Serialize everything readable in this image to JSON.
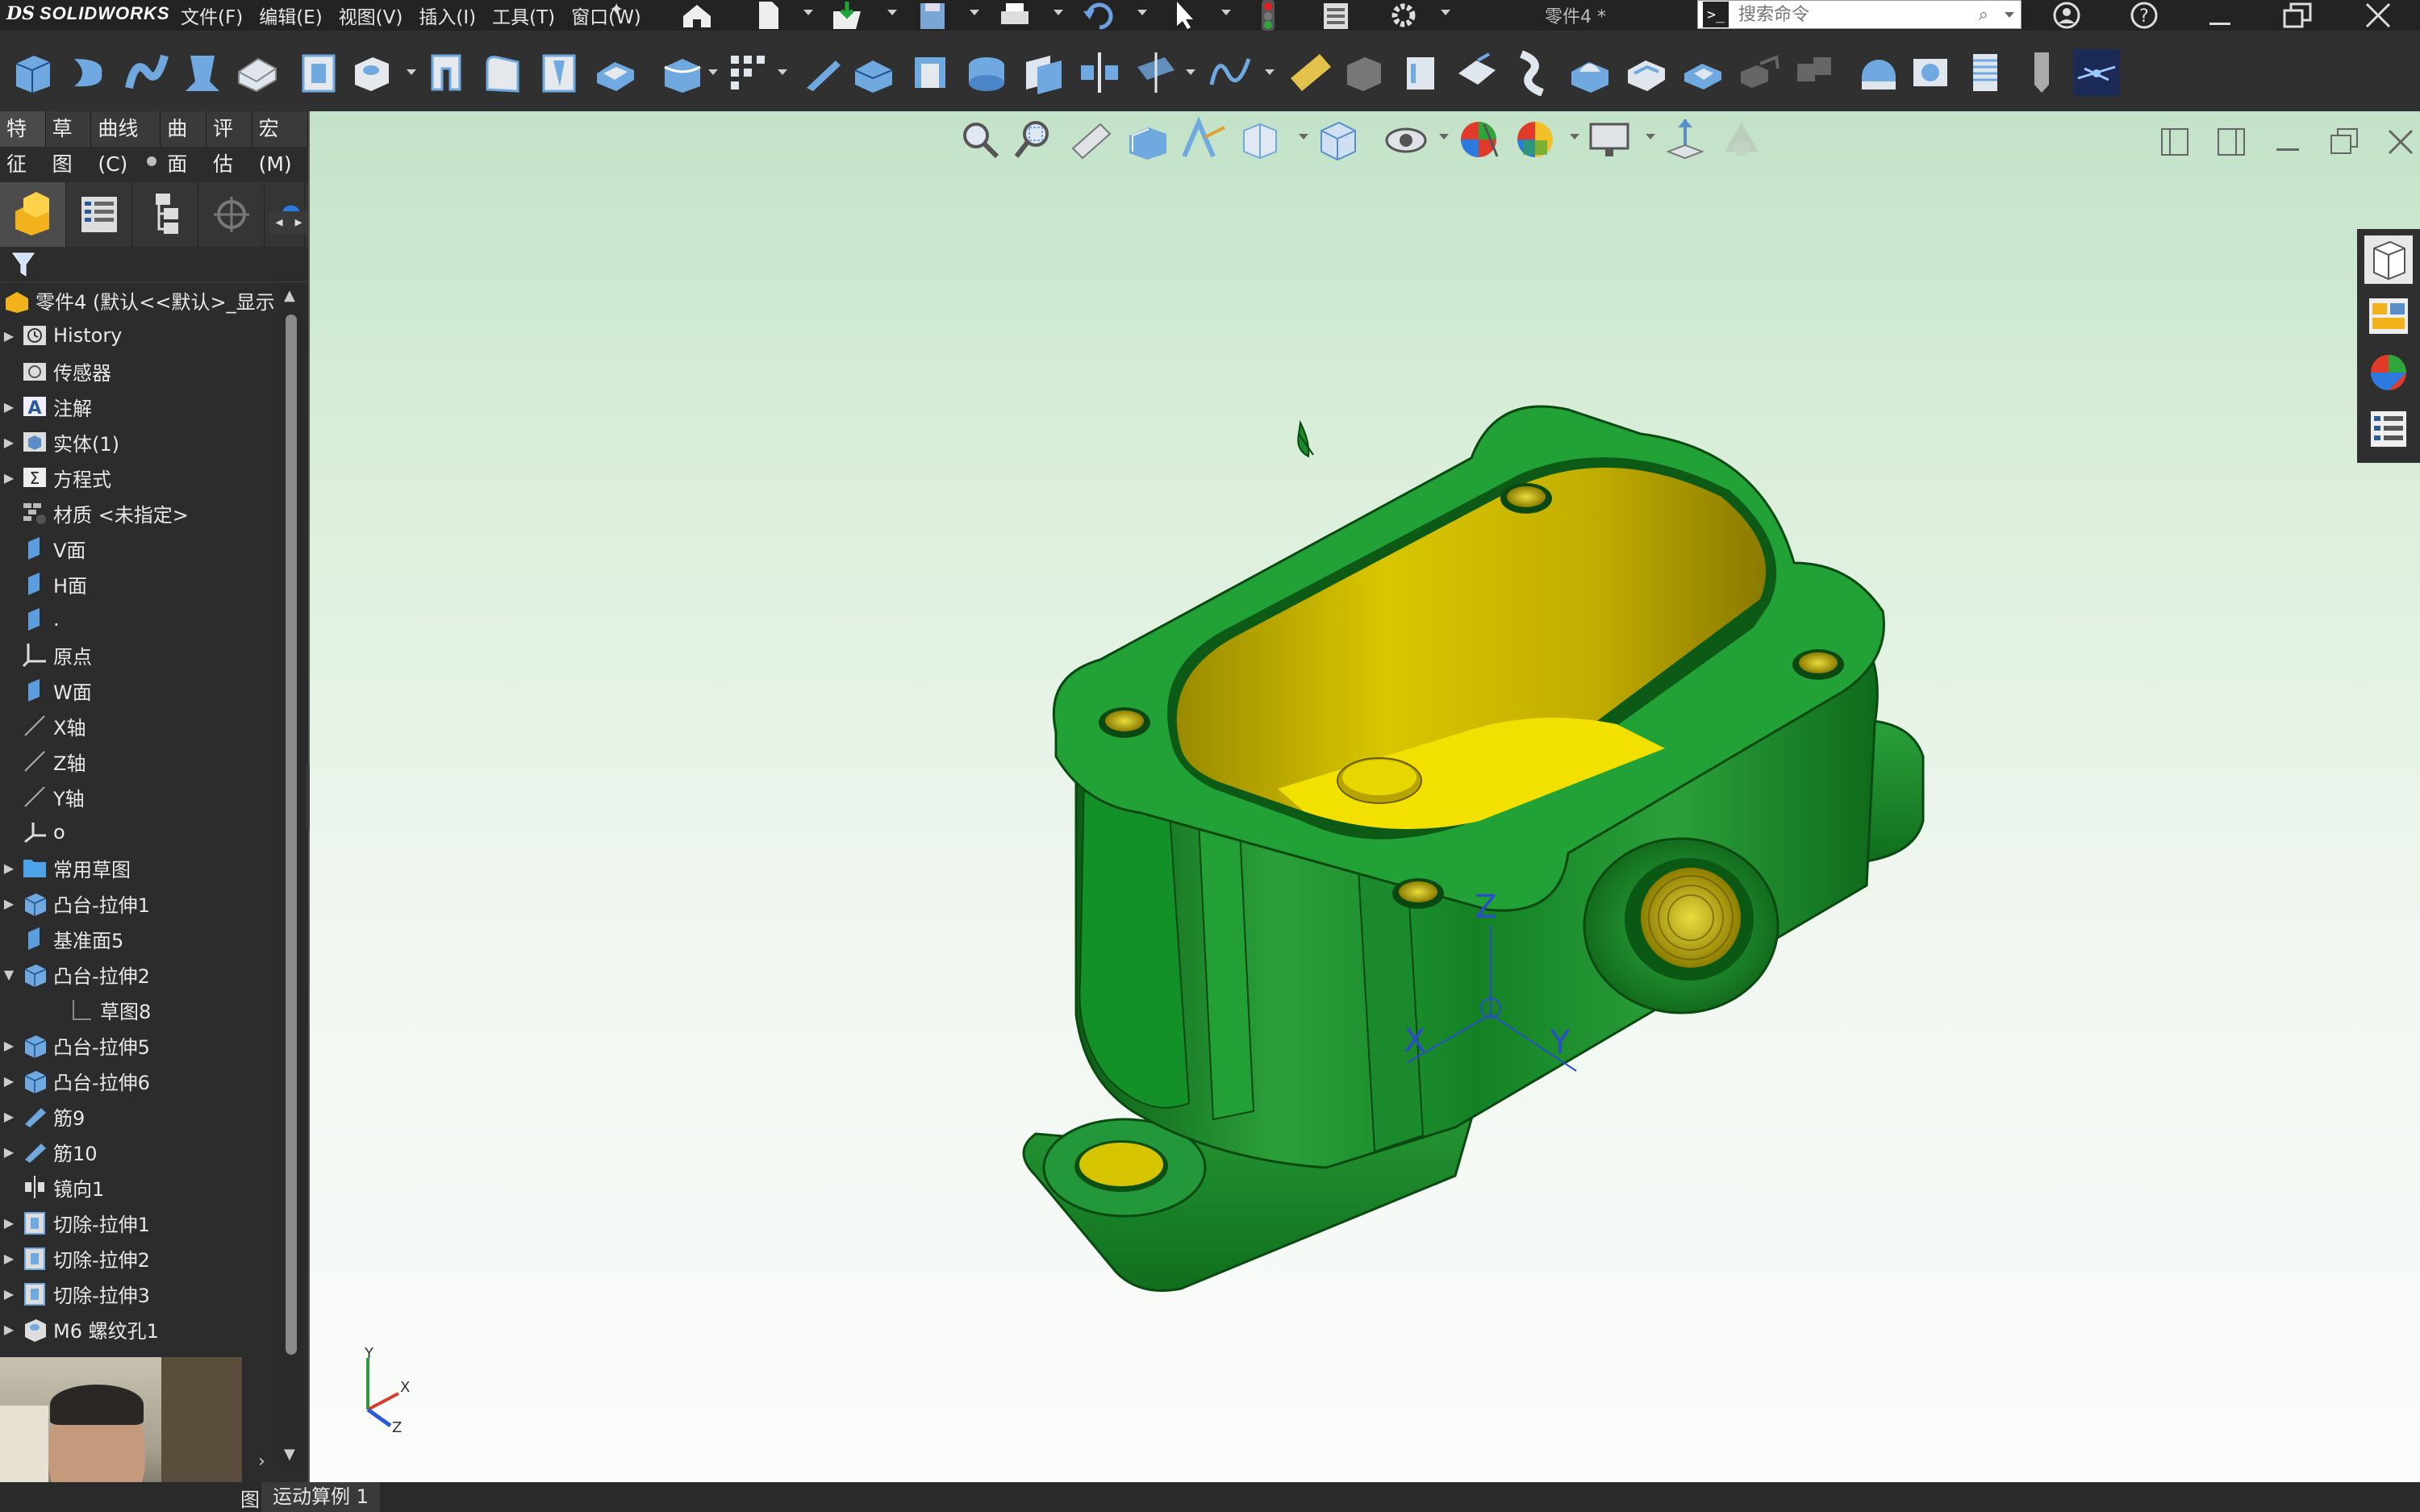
{
  "app": {
    "brand": "SOLIDWORKS",
    "brand_prefix": "DS",
    "document_title": "零件4 *",
    "menus": [
      "文件(F)",
      "编辑(E)",
      "视图(V)",
      "插入(I)",
      "工具(T)",
      "窗口(W)"
    ],
    "search_placeholder": "搜索命令"
  },
  "command_tabs": [
    "特征",
    "草图",
    "曲线(C)",
    "曲面",
    "评估",
    "宏(M)"
  ],
  "active_command_tab": "特征",
  "feature_tree": {
    "root_label": "零件4 (默认<<默认>_显示",
    "items": [
      {
        "label": "History",
        "expandable": true,
        "icon": "history-icon"
      },
      {
        "label": "传感器",
        "expandable": false,
        "icon": "sensor-icon"
      },
      {
        "label": "注解",
        "expandable": true,
        "icon": "annotation-icon"
      },
      {
        "label": "实体(1)",
        "expandable": true,
        "icon": "solid-body-icon"
      },
      {
        "label": "方程式",
        "expandable": true,
        "icon": "equation-icon"
      },
      {
        "label": "材质 <未指定>",
        "expandable": false,
        "icon": "material-icon"
      },
      {
        "label": "V面",
        "expandable": false,
        "icon": "plane-icon"
      },
      {
        "label": "H面",
        "expandable": false,
        "icon": "plane-icon"
      },
      {
        "label": ".",
        "expandable": false,
        "icon": "plane-icon"
      },
      {
        "label": "原点",
        "expandable": false,
        "icon": "origin-icon"
      },
      {
        "label": "W面",
        "expandable": false,
        "icon": "plane-icon"
      },
      {
        "label": "X轴",
        "expandable": false,
        "icon": "axis-icon"
      },
      {
        "label": "Z轴",
        "expandable": false,
        "icon": "axis-icon"
      },
      {
        "label": "Y轴",
        "expandable": false,
        "icon": "axis-icon"
      },
      {
        "label": "o",
        "expandable": false,
        "icon": "coordinate-system-icon"
      },
      {
        "label": "常用草图",
        "expandable": true,
        "icon": "folder-icon"
      },
      {
        "label": "凸台-拉伸1",
        "expandable": true,
        "icon": "boss-extrude-icon"
      },
      {
        "label": "基准面5",
        "expandable": false,
        "icon": "plane-icon"
      },
      {
        "label": "凸台-拉伸2",
        "expandable": true,
        "expanded": true,
        "icon": "boss-extrude-icon"
      },
      {
        "label": "草图8",
        "expandable": false,
        "child": true,
        "icon": "sketch-icon"
      },
      {
        "label": "凸台-拉伸5",
        "expandable": true,
        "icon": "boss-extrude-icon"
      },
      {
        "label": "凸台-拉伸6",
        "expandable": true,
        "icon": "boss-extrude-icon"
      },
      {
        "label": "筋9",
        "expandable": true,
        "icon": "rib-icon"
      },
      {
        "label": "筋10",
        "expandable": true,
        "icon": "rib-icon"
      },
      {
        "label": "镜向1",
        "expandable": false,
        "icon": "mirror-icon"
      },
      {
        "label": "切除-拉伸1",
        "expandable": true,
        "icon": "cut-extrude-icon"
      },
      {
        "label": "切除-拉伸2",
        "expandable": true,
        "icon": "cut-extrude-icon"
      },
      {
        "label": "切除-拉伸3",
        "expandable": true,
        "icon": "cut-extrude-icon"
      },
      {
        "label": "M6 螺纹孔1",
        "expandable": true,
        "icon": "hole-wizard-icon"
      }
    ]
  },
  "bottom_tabs": {
    "partial": "图",
    "motion_study": "运动算例 1"
  },
  "triad": {
    "x": "X",
    "y": "Y",
    "z": "Z"
  },
  "origin_axes": {
    "x": "X",
    "y": "Y",
    "z": "Z"
  },
  "colors": {
    "model_green": "#1f9a2e",
    "model_dark_green": "#0e5e18",
    "model_inner_yellow": "#e6d200",
    "viewport_top": "#c3e2c8",
    "viewport_bottom": "#fbfcfb",
    "ui_dark": "#2c2c2c"
  }
}
